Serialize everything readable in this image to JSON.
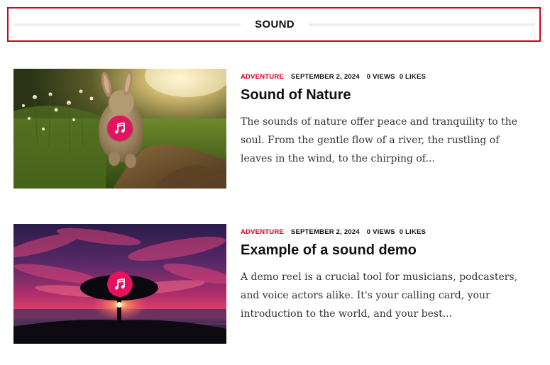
{
  "section": {
    "title": "SOUND"
  },
  "posts": [
    {
      "category": "ADVENTURE",
      "date": "SEPTEMBER 2, 2024",
      "views": "0 VIEWS",
      "likes": "0 LIKES",
      "title": "Sound of Nature",
      "excerpt": "The sounds of nature offer peace and tranquility to the soul. From the gentle flow of a river, the rustling of leaves in the wind, to the chirping of...",
      "badge_icon": "music-note-icon"
    },
    {
      "category": "ADVENTURE",
      "date": "SEPTEMBER 2, 2024",
      "views": "0 VIEWS",
      "likes": "0 LIKES",
      "title": "Example of a sound demo",
      "excerpt": "A demo reel is a crucial tool for musicians, podcasters, and voice actors alike. It's your calling card, your introduction to the world, and your best...",
      "badge_icon": "music-note-icon"
    }
  ],
  "colors": {
    "accent": "#d0021b",
    "badge": "#e3135e"
  }
}
